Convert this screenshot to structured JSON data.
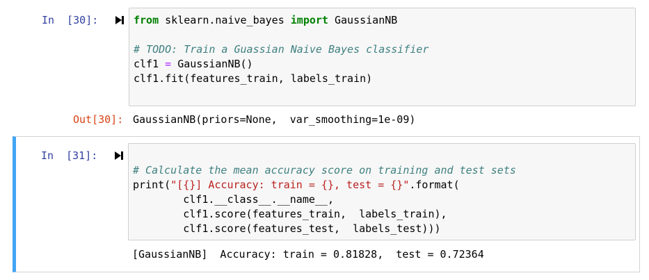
{
  "cells": [
    {
      "prompt_in": "In  [30]:",
      "prompt_out": "Out[30]:",
      "code": {
        "l1_kw1": "from",
        "l1_mod": " sklearn.naive_bayes ",
        "l1_kw2": "import",
        "l1_name": " GaussianNB",
        "l2_comment": "# TODO: Train a Guassian Naive Bayes classifier",
        "l3_a": "clf1 ",
        "l3_op": "=",
        "l3_b": " GaussianNB()",
        "l4": "clf1.fit(features_train, labels_train)"
      },
      "output": "GaussianNB(priors=None,  var_smoothing=1e-09)"
    },
    {
      "prompt_in": "In  [31]:",
      "code": {
        "l1_comment": "# Calculate the mean accuracy score on training and test sets",
        "l2_a": "print(",
        "l2_str": "\"[{}] Accuracy: train = {}, test = {}\"",
        "l2_b": ".format(",
        "l3": "        clf1.__class__.__name__,",
        "l4": "        clf1.score(features_train,  labels_train),",
        "l5": "        clf1.score(features_test,  labels_test)))"
      },
      "output": "[GaussianNB]  Accuracy: train = 0.81828,  test = 0.72364"
    }
  ],
  "colors": {
    "prompt_in": "#303f9f",
    "prompt_out": "#d84315",
    "keyword": "#008000",
    "comment": "#408080",
    "string": "#ba2121",
    "selected_cell_bar": "#42a5f5"
  },
  "icons": [
    "run-cell-icon",
    "run-cell-icon"
  ]
}
